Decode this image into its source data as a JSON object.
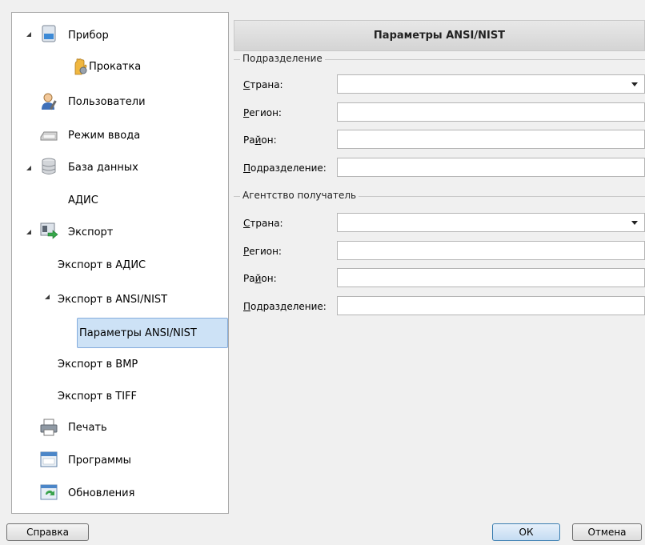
{
  "tree": {
    "items": [
      {
        "label": "Прибор",
        "icon": "device-icon"
      },
      {
        "label": "Прокатка",
        "icon": "hand-fingerprint-icon"
      },
      {
        "label": "Пользователи",
        "icon": "user-icon"
      },
      {
        "label": "Режим ввода",
        "icon": "keyboard-icon"
      },
      {
        "label": "База данных",
        "icon": "database-icon"
      },
      {
        "label": "АДИС",
        "icon": ""
      },
      {
        "label": "Экспорт",
        "icon": "export-icon"
      },
      {
        "label": "Экспорт в АДИС",
        "icon": ""
      },
      {
        "label": "Экспорт в ANSI/NIST",
        "icon": ""
      },
      {
        "label": "Параметры ANSI/NIST",
        "icon": ""
      },
      {
        "label": "Экспорт в BMP",
        "icon": ""
      },
      {
        "label": "Экспорт в TIFF",
        "icon": ""
      },
      {
        "label": "Печать",
        "icon": "printer-icon"
      },
      {
        "label": "Программы",
        "icon": "window-icon"
      },
      {
        "label": "Обновления",
        "icon": "update-icon"
      }
    ]
  },
  "panel": {
    "title": "Параметры ANSI/NIST",
    "groups": [
      {
        "title": "Подразделение",
        "fields": [
          {
            "label_u": "С",
            "label_rest": "трана:",
            "value": ""
          },
          {
            "label_u": "Р",
            "label_rest": "егион:",
            "value": ""
          },
          {
            "label_pre": "Ра",
            "label_u": "й",
            "label_rest": "он:",
            "value": ""
          },
          {
            "label_u": "П",
            "label_rest": "одразделение:",
            "value": ""
          }
        ]
      },
      {
        "title": "Агентство получатель",
        "fields": [
          {
            "label_u": "С",
            "label_rest": "трана:",
            "value": ""
          },
          {
            "label_u": "Р",
            "label_rest": "егион:",
            "value": ""
          },
          {
            "label_pre": "Ра",
            "label_u": "й",
            "label_rest": "он:",
            "value": ""
          },
          {
            "label_u": "П",
            "label_rest": "одразделение:",
            "value": ""
          }
        ]
      }
    ]
  },
  "buttons": {
    "help": "Справка",
    "ok": "ОК",
    "cancel": "Отмена"
  }
}
